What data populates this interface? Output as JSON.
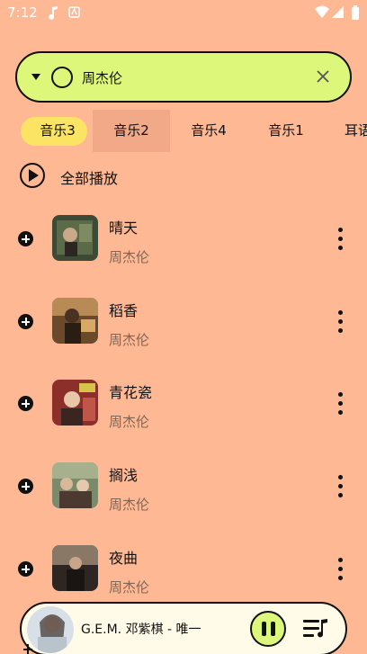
{
  "status_bar": {
    "time": "7:12"
  },
  "search": {
    "value": "周杰伦",
    "placeholder": ""
  },
  "tabs": [
    {
      "label": "音乐3",
      "selected": true
    },
    {
      "label": "音乐2",
      "selected": false
    },
    {
      "label": "音乐4",
      "selected": false
    },
    {
      "label": "音乐1",
      "selected": false
    },
    {
      "label": "耳语",
      "selected": false
    }
  ],
  "play_all": {
    "label": "全部播放"
  },
  "songs": [
    {
      "title": "晴天",
      "artist": "周杰伦"
    },
    {
      "title": "稻香",
      "artist": "周杰伦"
    },
    {
      "title": "青花瓷",
      "artist": "周杰伦"
    },
    {
      "title": "搁浅",
      "artist": "周杰伦"
    },
    {
      "title": "夜曲",
      "artist": "周杰伦"
    }
  ],
  "now_playing": {
    "text": "G.E.M. 邓紫棋  -  唯一"
  },
  "colors": {
    "background": "#ffb894",
    "search_bg": "#dcf77a",
    "tab_selected": "#fbe464",
    "player_bg": "#fffbe8"
  }
}
